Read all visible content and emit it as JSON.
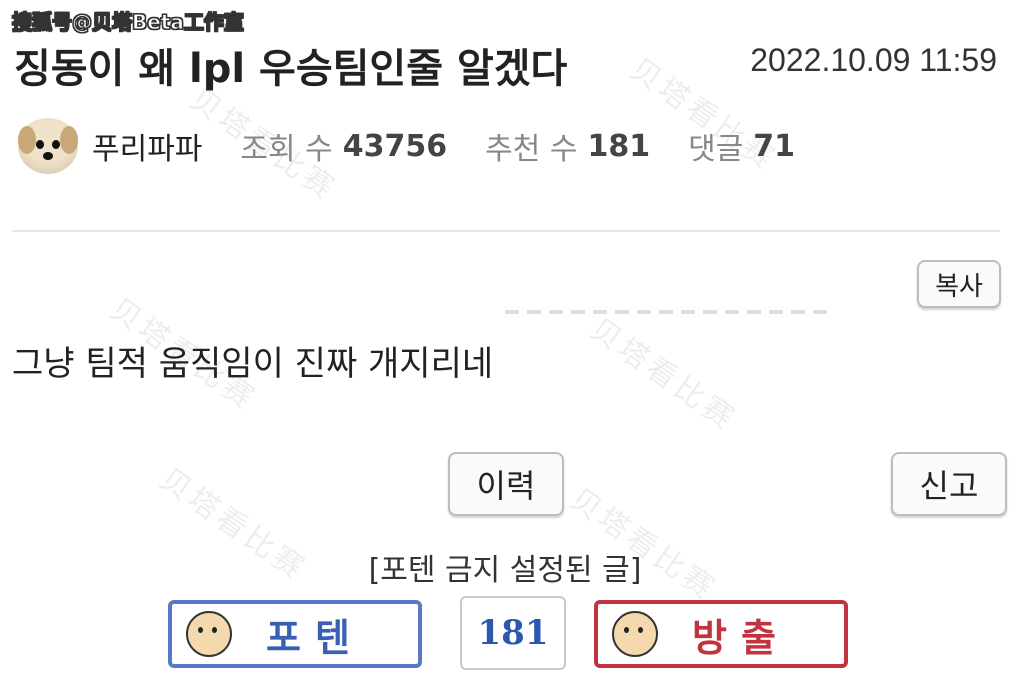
{
  "watermark": {
    "top_label": "搜狐号@贝塔Beta工作室",
    "background_text": "贝塔看比赛"
  },
  "post": {
    "title": "징동이 왜 lpl 우승팀인줄 알겠다",
    "datetime": "2022.10.09 11:59",
    "author": "푸리파파",
    "views_label": "조회 수",
    "views": "43756",
    "recommend_label": "추천 수",
    "recommend": "181",
    "comments_label": "댓글",
    "comments": "71",
    "body": "그냥 팀적 움직임이 진짜 개지리네"
  },
  "actions": {
    "copy_label": "복사",
    "history_label": "이력",
    "report_label": "신고"
  },
  "voting": {
    "banned_note": "[포텐 금지 설정된 글]",
    "up_label": "포텐",
    "count": "181",
    "down_label": "방출",
    "colors": {
      "up": "#5a79c4",
      "down": "#c0333f",
      "count": "#2b57b0"
    }
  }
}
